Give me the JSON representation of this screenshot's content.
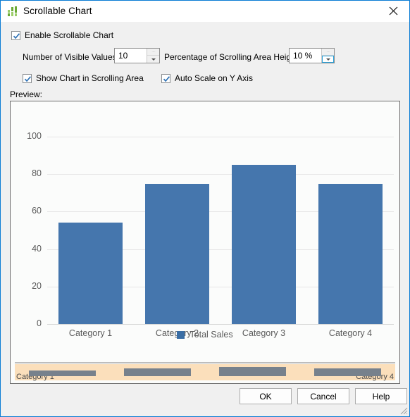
{
  "window": {
    "title": "Scrollable Chart",
    "icon": "bar-chart-icon",
    "close_icon": "close-icon",
    "accent_border": "#0a7bd4"
  },
  "options": {
    "enable_scrollable_chart": {
      "label": "Enable Scrollable Chart",
      "checked": true
    },
    "visible_values": {
      "label": "Number of Visible Values:",
      "value": "10"
    },
    "scrolling_area_height": {
      "label": "Percentage of Scrolling Area Height:",
      "value": "10 %"
    },
    "show_chart_in_scrolling_area": {
      "label": "Show Chart in Scrolling Area",
      "checked": true
    },
    "auto_scale_on_y_axis": {
      "label": "Auto Scale on Y Axis",
      "checked": true
    }
  },
  "preview": {
    "label": "Preview:"
  },
  "chart_data": {
    "type": "bar",
    "title": "",
    "xlabel": "",
    "ylabel": "",
    "categories": [
      "Category 1",
      "Category 2",
      "Category 3",
      "Category 4"
    ],
    "series": [
      {
        "name": "Total Sales",
        "values": [
          54,
          75,
          85,
          75
        ],
        "color": "#4576ad"
      }
    ],
    "yticks": [
      0,
      20,
      40,
      60,
      80,
      100
    ],
    "ylim": [
      0,
      100
    ],
    "grid": true,
    "legend_position": "bottom"
  },
  "scroll_overview": {
    "start_label": "Category 1",
    "end_label": "Category 4",
    "track_color": "#fbdfbb",
    "bar_color": "#77818c",
    "bars": [
      {
        "value": 54
      },
      {
        "value": 75
      },
      {
        "value": 85
      },
      {
        "value": 75
      }
    ]
  },
  "buttons": {
    "ok": "OK",
    "cancel": "Cancel",
    "help": "Help"
  },
  "resize_grip": "resize-grip-icon"
}
